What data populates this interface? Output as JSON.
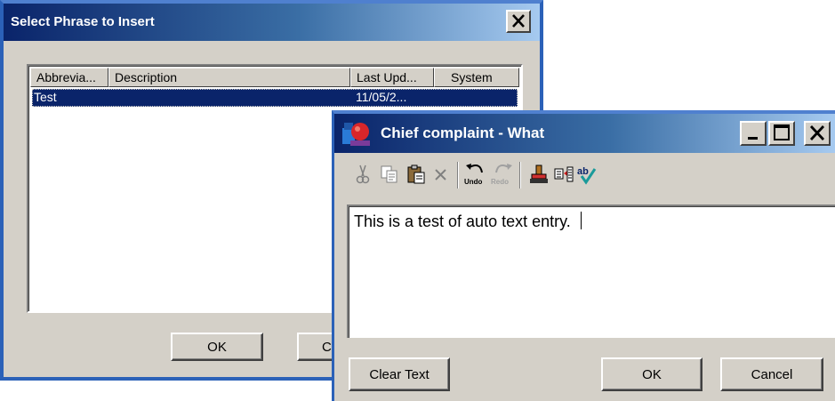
{
  "phrase_dialog": {
    "title": "Select Phrase to Insert",
    "columns": [
      "Abbrevia...",
      "Description",
      "Last Upd...",
      "System"
    ],
    "rows": [
      {
        "abbreviation": "Test",
        "description": "",
        "last_updated": "11/05/2...",
        "system": "",
        "selected": true
      }
    ],
    "ok_label": "OK",
    "cancel_label_visible": "C"
  },
  "complaint_dialog": {
    "title": "Chief complaint - What",
    "toolbar": {
      "undo_label": "Undo",
      "redo_label": "Redo",
      "icons": [
        "cut-icon",
        "copy-icon",
        "paste-icon",
        "delete-icon",
        "undo-icon",
        "redo-icon",
        "stamp-icon",
        "insert-phrase-icon",
        "spell-check-icon"
      ]
    },
    "text_value": "This is a test of auto text entry. ",
    "clear_label": "Clear Text",
    "ok_label": "OK",
    "cancel_label": "Cancel"
  },
  "colors": {
    "title_gradient_start": "#0a246a",
    "title_gradient_end": "#a6caf0",
    "face": "#d4d0c8",
    "selection": "#0a246a",
    "window_border": "#2b61b8"
  }
}
